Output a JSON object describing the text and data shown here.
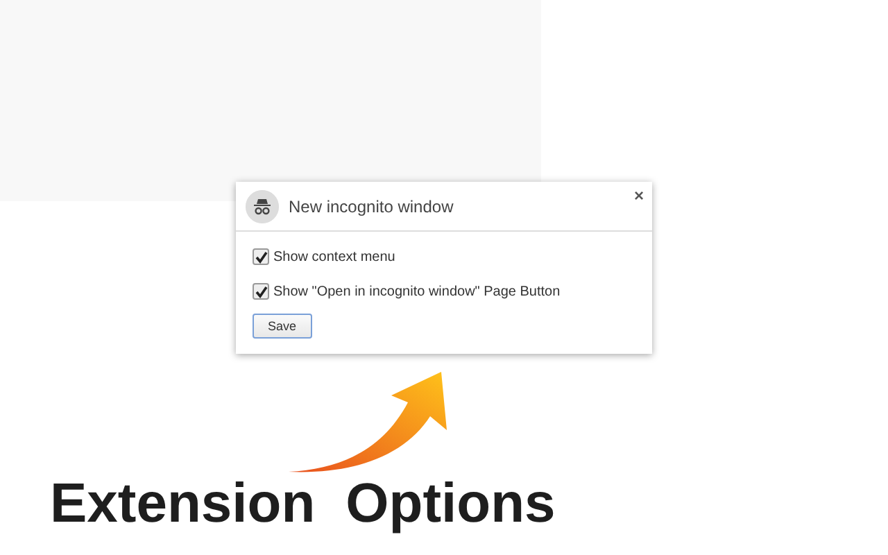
{
  "dialog": {
    "title": "New incognito window",
    "close": "×",
    "options": [
      {
        "label": "Show context menu",
        "checked": true
      },
      {
        "label": "Show \"Open in incognito window\" Page Button",
        "checked": true
      }
    ],
    "button": "Save"
  },
  "caption": {
    "words": [
      "Extension",
      "Options"
    ]
  }
}
